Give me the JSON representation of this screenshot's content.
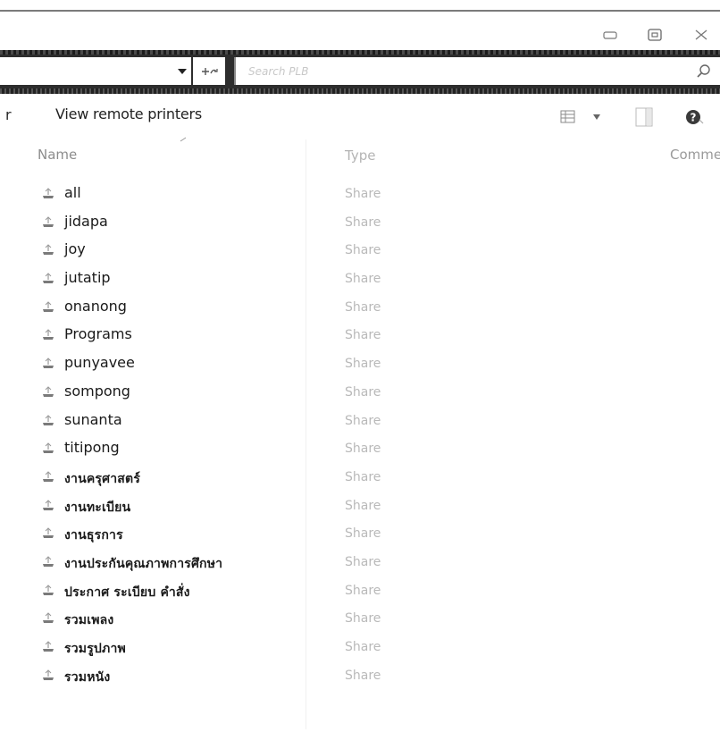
{
  "window": {
    "minimize_icon": "minimize-icon",
    "maximize_icon": "maximize-icon",
    "close_icon": "close-icon"
  },
  "address_bar": {
    "dropdown_icon": "chevron-down-icon",
    "refresh_icon": "refresh-icon"
  },
  "search": {
    "placeholder": "Search PLB",
    "icon": "search-icon"
  },
  "toolbar": {
    "fragment": "r",
    "view_remote_printers": "View remote printers",
    "view_options_icon": "view-options-icon",
    "preview_pane_icon": "preview-pane-icon",
    "help_icon": "help-icon"
  },
  "columns": {
    "name": "Name",
    "type": "Type",
    "comment": "Comme"
  },
  "files": [
    {
      "name": "all",
      "type": "Share"
    },
    {
      "name": "jidapa",
      "type": "Share"
    },
    {
      "name": "joy",
      "type": "Share"
    },
    {
      "name": "jutatip",
      "type": "Share"
    },
    {
      "name": "onanong",
      "type": "Share"
    },
    {
      "name": "Programs",
      "type": "Share"
    },
    {
      "name": "punyavee",
      "type": "Share"
    },
    {
      "name": "sompong",
      "type": "Share"
    },
    {
      "name": "sunanta",
      "type": "Share"
    },
    {
      "name": "titipong",
      "type": "Share"
    },
    {
      "name": "งานครุศาสตร์",
      "type": "Share"
    },
    {
      "name": "งานทะเบียน",
      "type": "Share"
    },
    {
      "name": "งานธุรการ",
      "type": "Share"
    },
    {
      "name": "งานประกันคุณภาพการศึกษา",
      "type": "Share"
    },
    {
      "name": "ประกาศ ระเบียบ คำสั่ง",
      "type": "Share"
    },
    {
      "name": "รวมเพลง",
      "type": "Share"
    },
    {
      "name": "รวมรูปภาพ",
      "type": "Share"
    },
    {
      "name": "รวมหนัง",
      "type": "Share"
    }
  ],
  "colors": {
    "accent_dark": "#2d2d2d",
    "muted_text": "#b9b9b9"
  }
}
